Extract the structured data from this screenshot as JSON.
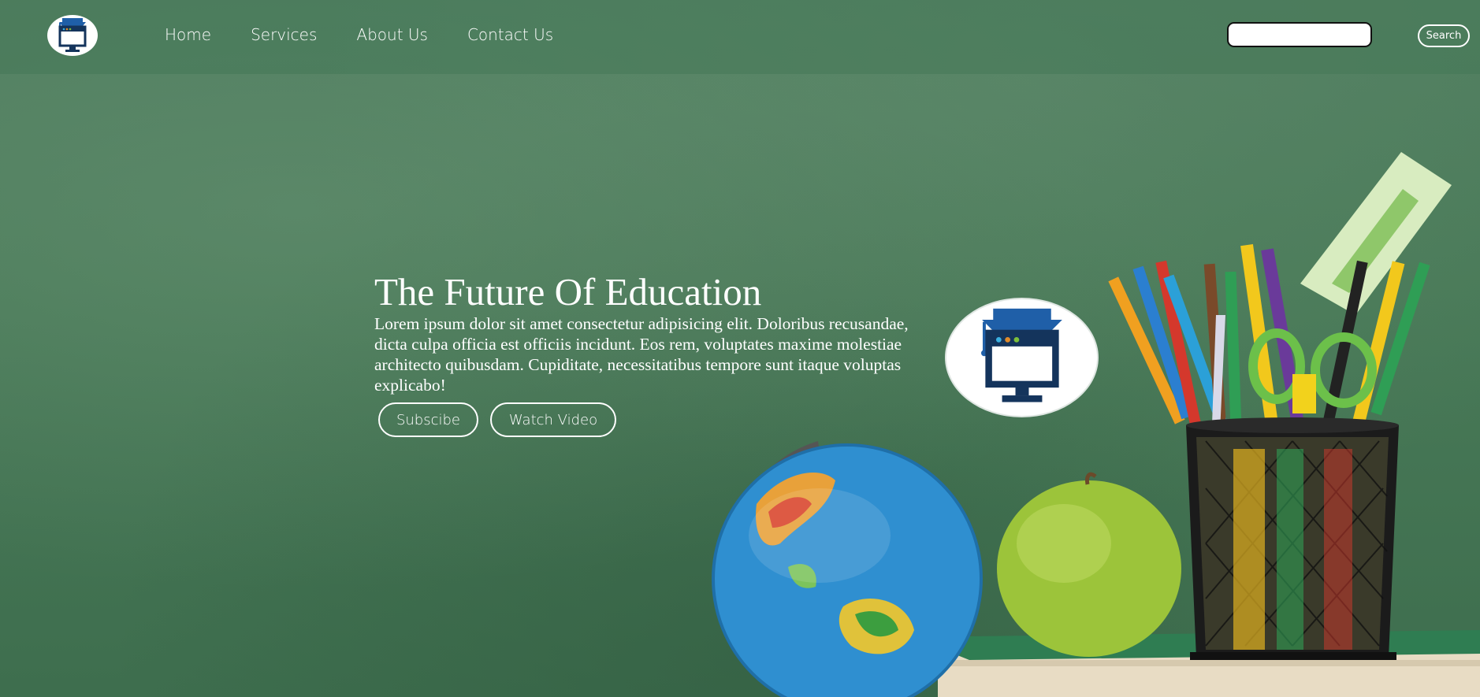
{
  "nav": {
    "logo_icon": "education-computer-icon",
    "links": [
      "Home",
      "Services",
      "About Us",
      "Contact Us"
    ],
    "search_placeholder": "",
    "search_button": "Search"
  },
  "hero": {
    "title": "The Future Of Education",
    "body": "Lorem ipsum dolor sit amet consectetur adipisicing elit. Doloribus recusandae, dicta culpa officia est officiis incidunt. Eos rem, voluptates maxime molestiae architecto quibusdam. Cupiditate, necessitatibus tempore sunt itaque voluptas explicabo!",
    "buttons": {
      "subscribe": "Subscibe",
      "watch": "Watch Video"
    },
    "logo_icon": "education-computer-icon"
  },
  "background": {
    "description_icons": [
      "globe-icon",
      "apple-icon",
      "pencil-cup-icon",
      "books-icon"
    ],
    "colors": {
      "chalkboard": "#4d7a5c",
      "logo_blue": "#1a3f6b",
      "cap_blue": "#1f5fa8"
    }
  }
}
